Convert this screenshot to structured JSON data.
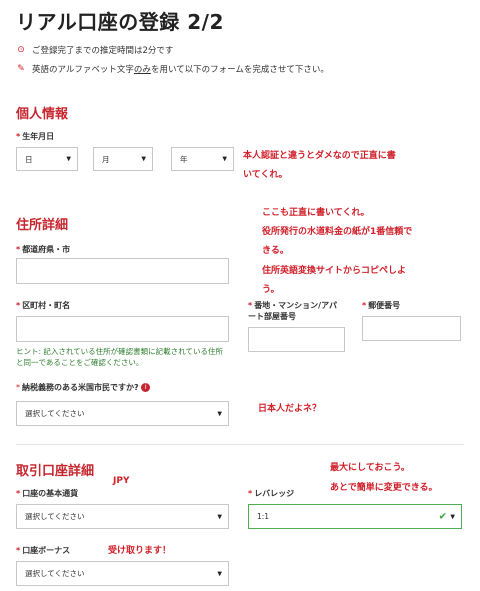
{
  "page": {
    "title": "リアル口座の登録 2/2",
    "info_time": "ご登録完了までの推定時間は2分です",
    "info_lang_before": "英語のアルファベット文字",
    "info_lang_underline": "のみ",
    "info_lang_after": "を用いて以下のフォームを完成させて下さい。"
  },
  "personal": {
    "heading": "個人情報",
    "dob_label": "生年月日",
    "day": "日",
    "month": "月",
    "year": "年"
  },
  "address": {
    "heading": "住所詳細",
    "prefecture_label": "都道府県・市",
    "ward_label": "区町村・町名",
    "street_label_1": "番地・マンション/アパ",
    "street_label_2": "ート部屋番号",
    "postal_label": "郵便番号",
    "hint_1": "ヒント: 記入されている住所が確認書類に記載されている住所",
    "hint_2": "と同一であることをご確認ください。",
    "us_label": "納税義務のある米国市民ですか?",
    "us_select": "選択してください"
  },
  "trading": {
    "heading": "取引口座詳細",
    "currency_label": "口座の基本通貨",
    "currency_select": "選択してください",
    "leverage_label": "レバレッジ",
    "leverage_select": "1:1",
    "bonus_label": "口座ボーナス",
    "bonus_select": "選択してください"
  },
  "annotations": {
    "dob_1": "本人認証と違うとダメなので正直に書",
    "dob_2": "いてくれ。",
    "addr_1": "ここも正直に書いてくれ。",
    "addr_2": "役所発行の水道料金の紙が1番信頼で",
    "addr_3": "きる。",
    "addr_4": "住所英語変換サイトからコピペしよ",
    "addr_5": "う。",
    "us": "日本人だよネ？",
    "jpy": "JPY",
    "lev_1": "最大にしておこう。",
    "lev_2": "あとで簡単に変更できる。",
    "bonus": "受け取ります！"
  }
}
